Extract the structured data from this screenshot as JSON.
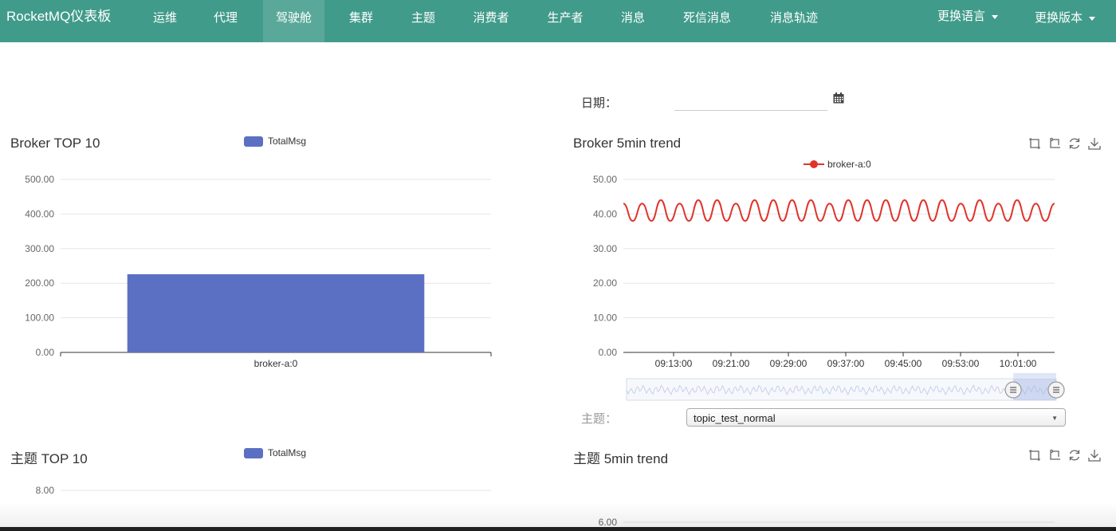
{
  "navbar": {
    "brand": "RocketMQ仪表板",
    "items": [
      {
        "label": "运维"
      },
      {
        "label": "代理"
      },
      {
        "label": "驾驶舱"
      },
      {
        "label": "集群"
      },
      {
        "label": "主题"
      },
      {
        "label": "消费者"
      },
      {
        "label": "生产者"
      },
      {
        "label": "消息"
      },
      {
        "label": "死信消息"
      },
      {
        "label": "消息轨迹"
      }
    ],
    "language_label": "更换语言",
    "version_label": "更换版本"
  },
  "filters": {
    "date_label": "日期：",
    "date_value": "",
    "topic_label": "主题：",
    "topic_selected": "topic_test_normal"
  },
  "colors": {
    "nav_bg": "#419b8a",
    "nav_active": "#5aa899",
    "bar": "#5b70c3",
    "line": "#e0342b"
  },
  "panels": {
    "broker_top10": {
      "title": "Broker TOP 10",
      "legend": "TotalMsg"
    },
    "broker_trend": {
      "title": "Broker 5min trend",
      "legend": "broker-a:0"
    },
    "topic_top10": {
      "title": "主题 TOP 10",
      "legend": "TotalMsg"
    },
    "topic_trend": {
      "title": "主题 5min trend"
    }
  },
  "chart_data": [
    {
      "type": "bar",
      "categories": [
        "broker-a:0"
      ],
      "series": [
        {
          "name": "TotalMsg",
          "values": [
            226
          ]
        }
      ],
      "ylim": [
        0,
        500
      ],
      "yticks": [
        "0.00",
        "100.00",
        "200.00",
        "300.00",
        "400.00",
        "500.00"
      ],
      "grid": true,
      "legend_position": "top-center"
    },
    {
      "type": "line",
      "x": [
        "09:13:00",
        "09:21:00",
        "09:29:00",
        "09:37:00",
        "09:45:00",
        "09:53:00",
        "10:01:00"
      ],
      "series": [
        {
          "name": "broker-a:0",
          "values": [
            43,
            38,
            43,
            38,
            44,
            38,
            43,
            38,
            44,
            38,
            44,
            38,
            43,
            38,
            44,
            38,
            44,
            38,
            44,
            38,
            44,
            38,
            43,
            38,
            44,
            38,
            44,
            38,
            44,
            38,
            44,
            38,
            44,
            38,
            44,
            38,
            43,
            38,
            44,
            38,
            43,
            38,
            44,
            38,
            43,
            38,
            43
          ]
        }
      ],
      "ylim": [
        0,
        50
      ],
      "yticks": [
        "0.00",
        "10.00",
        "20.00",
        "30.00",
        "40.00",
        "50.00"
      ],
      "grid": true,
      "legend_position": "top-center",
      "datazoom_range": [
        0.9,
        1.0
      ]
    },
    {
      "type": "bar",
      "categories": [],
      "series": [
        {
          "name": "TotalMsg",
          "values": []
        }
      ],
      "yticks": [
        "8.00"
      ],
      "grid": true,
      "legend_position": "top-center"
    },
    {
      "type": "line",
      "x": [],
      "series": [],
      "yticks": [
        "6.00"
      ],
      "grid": true
    }
  ]
}
